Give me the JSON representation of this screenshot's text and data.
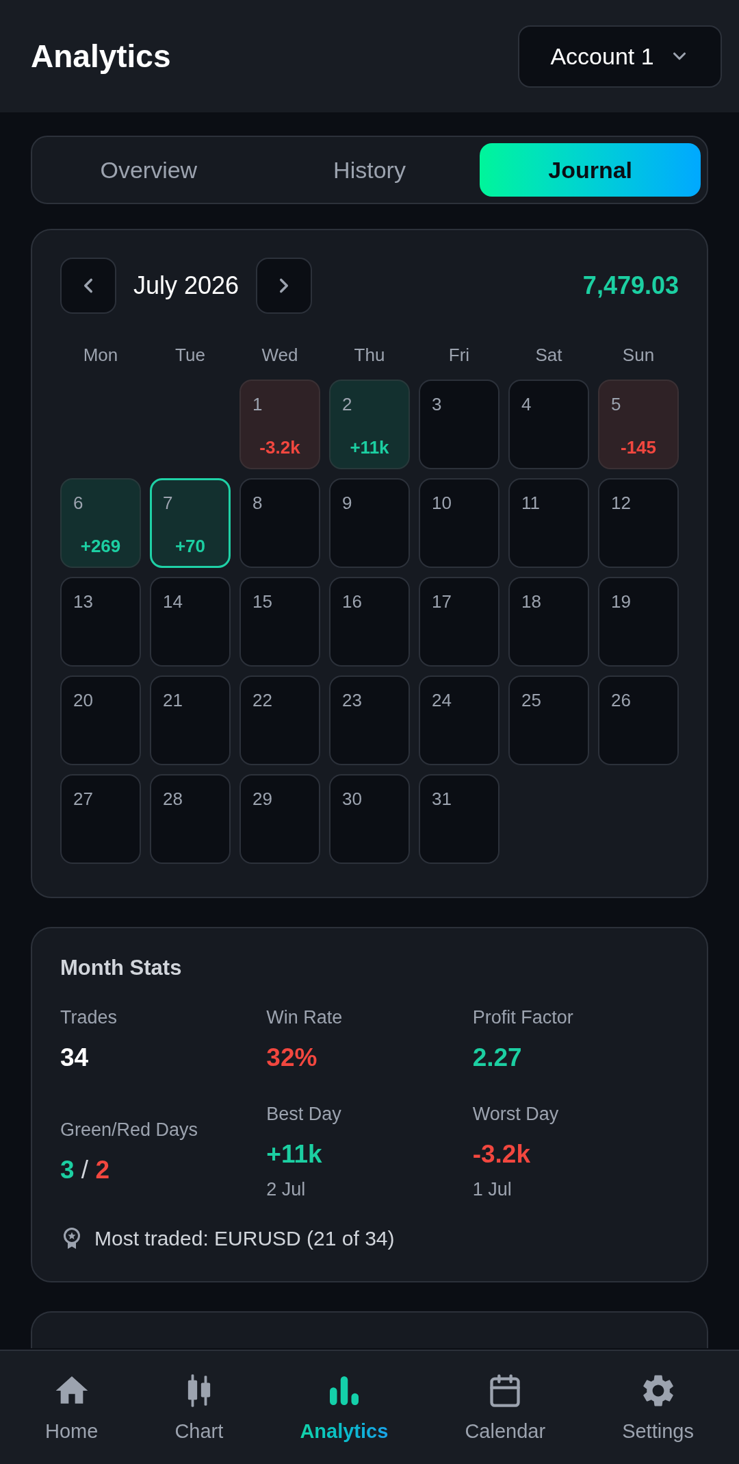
{
  "header": {
    "title": "Analytics",
    "account_selector": {
      "label": "Account 1"
    }
  },
  "tabs": [
    {
      "label": "Overview",
      "selected": false
    },
    {
      "label": "History",
      "selected": false
    },
    {
      "label": "Journal",
      "selected": true
    }
  ],
  "calendar": {
    "month": "July 2026",
    "total": "7,479.03",
    "weekdays": [
      "Mon",
      "Tue",
      "Wed",
      "Thu",
      "Fri",
      "Sat",
      "Sun"
    ],
    "days": [
      {
        "kind": "blank"
      },
      {
        "kind": "blank"
      },
      {
        "kind": "loss",
        "date": "1",
        "pnl": "-3.2k",
        "selected": false
      },
      {
        "kind": "win",
        "date": "2",
        "pnl": "+11k",
        "selected": false
      },
      {
        "kind": "empty",
        "date": "3",
        "selected": false
      },
      {
        "kind": "empty",
        "date": "4",
        "selected": false
      },
      {
        "kind": "loss",
        "date": "5",
        "pnl": "-145",
        "selected": false
      },
      {
        "kind": "win",
        "date": "6",
        "pnl": "+269",
        "selected": false
      },
      {
        "kind": "win",
        "date": "7",
        "pnl": "+70",
        "selected": true
      },
      {
        "kind": "empty",
        "date": "8",
        "selected": false
      },
      {
        "kind": "empty",
        "date": "9",
        "selected": false
      },
      {
        "kind": "empty",
        "date": "10",
        "selected": false
      },
      {
        "kind": "empty",
        "date": "11",
        "selected": false
      },
      {
        "kind": "empty",
        "date": "12",
        "selected": false
      },
      {
        "kind": "empty",
        "date": "13",
        "selected": false
      },
      {
        "kind": "empty",
        "date": "14",
        "selected": false
      },
      {
        "kind": "empty",
        "date": "15",
        "selected": false
      },
      {
        "kind": "empty",
        "date": "16",
        "selected": false
      },
      {
        "kind": "empty",
        "date": "17",
        "selected": false
      },
      {
        "kind": "empty",
        "date": "18",
        "selected": false
      },
      {
        "kind": "empty",
        "date": "19",
        "selected": false
      },
      {
        "kind": "empty",
        "date": "20",
        "selected": false
      },
      {
        "kind": "empty",
        "date": "21",
        "selected": false
      },
      {
        "kind": "empty",
        "date": "22",
        "selected": false
      },
      {
        "kind": "empty",
        "date": "23",
        "selected": false
      },
      {
        "kind": "empty",
        "date": "24",
        "selected": false
      },
      {
        "kind": "empty",
        "date": "25",
        "selected": false
      },
      {
        "kind": "empty",
        "date": "26",
        "selected": false
      },
      {
        "kind": "empty",
        "date": "27",
        "selected": false
      },
      {
        "kind": "empty",
        "date": "28",
        "selected": false
      },
      {
        "kind": "empty",
        "date": "29",
        "selected": false
      },
      {
        "kind": "empty",
        "date": "30",
        "selected": false
      },
      {
        "kind": "empty",
        "date": "31",
        "selected": false
      }
    ]
  },
  "month_stats": {
    "title": "Month Stats",
    "items": [
      {
        "kind": "value",
        "label": "Trades",
        "value": "34",
        "color": "#ffffff"
      },
      {
        "kind": "value",
        "label": "Win Rate",
        "value": "32%",
        "color": "#f2473f"
      },
      {
        "kind": "value",
        "label": "Profit Factor",
        "value": "2.27",
        "color": "#1ccfa2"
      },
      {
        "kind": "ratio",
        "label": "Green/Red Days",
        "green": "3",
        "separator": "/",
        "red": "2"
      },
      {
        "kind": "value",
        "label": "Best Day",
        "value": "+11k",
        "color": "#1ccfa2",
        "date": "2 Jul"
      },
      {
        "kind": "value",
        "label": "Worst Day",
        "value": "-3.2k",
        "color": "#f2473f",
        "date": "1 Jul"
      }
    ],
    "most_traded": "Most traded: EURUSD (21 of 34)"
  },
  "bottom_nav": {
    "items": [
      {
        "label": "Home",
        "selected": false
      },
      {
        "label": "Chart",
        "selected": false
      },
      {
        "label": "Analytics",
        "selected": true
      },
      {
        "label": "Calendar",
        "selected": false
      },
      {
        "label": "Settings",
        "selected": false
      }
    ]
  }
}
